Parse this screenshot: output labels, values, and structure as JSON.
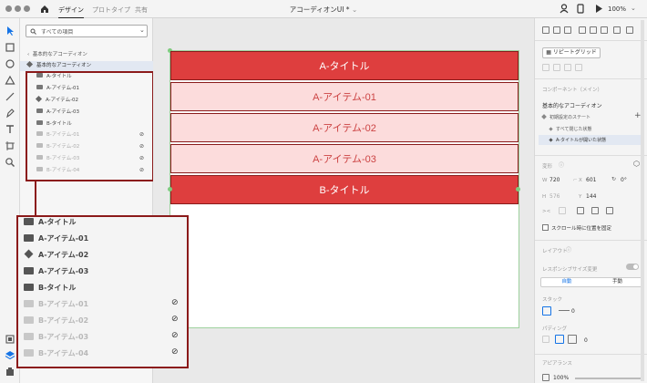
{
  "titlebar": {
    "tabs": [
      "デザイン",
      "プロトタイプ",
      "共有"
    ],
    "doc_title": "アコーディオンUI *",
    "zoom": "100%"
  },
  "layers": {
    "search_placeholder": "すべての項目",
    "breadcrumb": "基本的なアコーディオン",
    "component_name": "基本的なアコーディオン",
    "items": [
      {
        "label": "A-タイトル",
        "icon": "folder",
        "dim": false,
        "hidden": false
      },
      {
        "label": "A-アイテム-01",
        "icon": "folder",
        "dim": false,
        "hidden": false
      },
      {
        "label": "A-アイテム-02",
        "icon": "component",
        "dim": false,
        "hidden": false
      },
      {
        "label": "A-アイテム-03",
        "icon": "folder",
        "dim": false,
        "hidden": false
      },
      {
        "label": "B-タイトル",
        "icon": "folder",
        "dim": false,
        "hidden": false
      },
      {
        "label": "B-アイテム-01",
        "icon": "folder",
        "dim": true,
        "hidden": true
      },
      {
        "label": "B-アイテム-02",
        "icon": "folder",
        "dim": true,
        "hidden": true
      },
      {
        "label": "B-アイテム-03",
        "icon": "folder",
        "dim": true,
        "hidden": true
      },
      {
        "label": "B-アイテム-04",
        "icon": "folder",
        "dim": true,
        "hidden": true
      }
    ]
  },
  "canvas": {
    "rows": [
      {
        "label": "A-タイトル",
        "kind": "header"
      },
      {
        "label": "A-アイテム-01",
        "kind": "item"
      },
      {
        "label": "A-アイテム-02",
        "kind": "item"
      },
      {
        "label": "A-アイテム-03",
        "kind": "item"
      },
      {
        "label": "B-タイトル",
        "kind": "header"
      }
    ]
  },
  "props": {
    "repeat_grid": "リピートグリッド",
    "component_section": "コンポーネント（メイン）",
    "component_name": "基本的なアコーディオン",
    "state_default": "初期設定のステート",
    "state_closed": "すべて閉じた状態",
    "state_open": "A-タイトルが開いた状態",
    "transform_label": "変形",
    "w_label": "W",
    "w_value": "720",
    "x_label": "X",
    "x_value": "601",
    "rotate_value": "0°",
    "h_label": "H",
    "h_value": "576",
    "y_label": "Y",
    "y_value": "144",
    "scroll_fix": "スクロール時に位置を固定",
    "layout_label": "レイアウト",
    "responsive_label": "レスポンシブサイズ変更",
    "auto_label": "自動",
    "manual_label": "手動",
    "stack_label": "スタック",
    "stack_value": "0",
    "padding_label": "パディング",
    "padding_value": "0",
    "appearance_label": "アピアランス",
    "opacity_value": "100%"
  },
  "colors": {
    "header_fill": "#de3e3e",
    "item_fill": "#fcdcdc",
    "border": "#8a1b1b",
    "accent": "#1473e6"
  }
}
